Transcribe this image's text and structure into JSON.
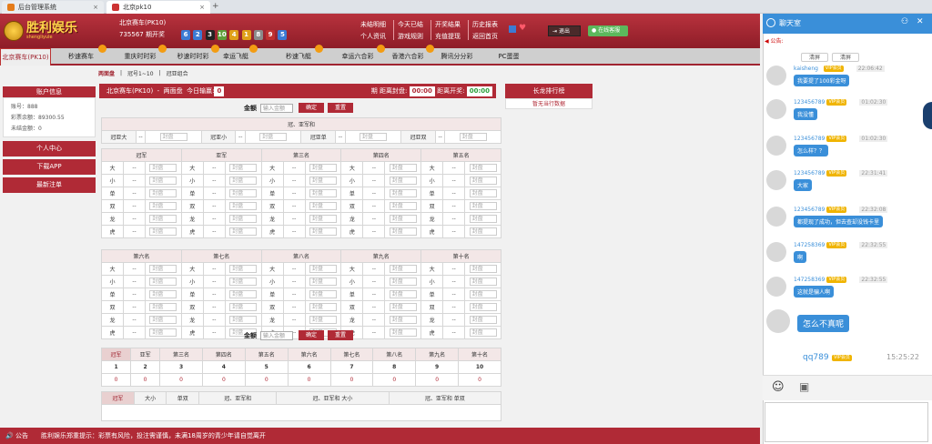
{
  "browser": {
    "tabs": [
      {
        "label": "后台管理系统"
      },
      {
        "label": "北京pk10"
      }
    ],
    "new_tab": "+"
  },
  "header": {
    "logo_main": "胜利娱乐",
    "logo_sub": "shengliyule",
    "game_name": "北京赛车(PK10)",
    "issue": "735567 期开奖",
    "balls": [
      {
        "n": "6",
        "c": "#3c7bd4"
      },
      {
        "n": "2",
        "c": "#3c7bd4"
      },
      {
        "n": "3",
        "c": "#222222"
      },
      {
        "n": "10",
        "c": "#5e9f3a"
      },
      {
        "n": "4",
        "c": "#e0a01a"
      },
      {
        "n": "1",
        "c": "#e0a01a"
      },
      {
        "n": "8",
        "c": "#8b8b8b"
      },
      {
        "n": "9",
        "c": "#c03030"
      },
      {
        "n": "5",
        "c": "#3c7bd4"
      }
    ],
    "links_top": [
      "未结明细",
      "今天已结",
      "开奖结果",
      "历史报表"
    ],
    "links_bottom": [
      "个人资讯",
      "游戏规则",
      "充值提现",
      "返回首页"
    ],
    "exit": "退出",
    "online": "在线客服"
  },
  "nav": {
    "items": [
      "北京赛车(PK10)",
      "秒速赛车",
      "重庆时时彩",
      "秒速时时彩",
      "幸运飞艇",
      "秒速飞艇",
      "幸运六合彩",
      "香港六合彩",
      "腾讯分分彩",
      "PC蛋蛋"
    ]
  },
  "subnav": [
    "两面盘",
    "冠号1~10",
    "冠亚组合"
  ],
  "sidebar": {
    "title": "账户信息",
    "account_label": "账号：",
    "account": "888",
    "balance_label": "彩票余额：",
    "balance": "89300.55",
    "unsettled_label": "未结金额：",
    "unsettled": "0",
    "buttons": [
      "个人中心",
      "下载APP",
      "最新注单"
    ]
  },
  "gamebar": {
    "game": "北京赛车(PK10)",
    "mode": "两面盘",
    "today_label": "今日输赢:",
    "today": "0",
    "close_label": "期 距离封盘:",
    "close": "00:00",
    "open_label": "距离开奖:",
    "open": "00:00"
  },
  "long_dragon": {
    "title": "长龙排行榜",
    "empty": "暂无当行数据"
  },
  "bet": {
    "amount_label": "金额",
    "placeholder": "输入金额",
    "confirm": "确定",
    "reset": "重置",
    "disabled": "封盘",
    "dash": "--"
  },
  "champion": {
    "title": "冠、亚军和",
    "items": [
      "冠亚大",
      "冠亚小",
      "冠亚单",
      "冠亚双"
    ]
  },
  "groups1": [
    "冠军",
    "亚军",
    "第三名",
    "第四名",
    "第五名"
  ],
  "groups2": [
    "第六名",
    "第七名",
    "第八名",
    "第九名",
    "第十名"
  ],
  "options": [
    "大",
    "小",
    "单",
    "双",
    "龙",
    "虎"
  ],
  "summary": {
    "headers": [
      "冠军",
      "亚军",
      "第三名",
      "第四名",
      "第五名",
      "第六名",
      "第七名",
      "第八名",
      "第九名",
      "第十名"
    ],
    "nums": [
      "1",
      "2",
      "3",
      "4",
      "5",
      "6",
      "7",
      "8",
      "9",
      "10"
    ],
    "vals": [
      "0",
      "0",
      "0",
      "0",
      "0",
      "0",
      "0",
      "0",
      "0",
      "0"
    ]
  },
  "tabs2": [
    "冠军",
    "大小",
    "单双",
    "冠、亚军和",
    "冠、亚军和 大小",
    "冠、亚军和 单双"
  ],
  "bottom": {
    "label": "公告",
    "text": "胜利娱乐郑重提示：彩票有风险，投注需谨慎，未满18周岁的青少年请自觉离开"
  },
  "chat": {
    "title": "聊天室",
    "notice": "公告:",
    "btn_a": "清屏",
    "btn_b": "清屏",
    "messages": [
      {
        "user": "kaisheng",
        "badge": "VIP会员",
        "time": "22:06:42",
        "text": "我要提了100彩金呀"
      },
      {
        "user": "123456789",
        "badge": "VIP会员",
        "time": "01:02:30",
        "text": "我没懂"
      },
      {
        "user": "123456789",
        "badge": "VIP会员",
        "time": "01:02:30",
        "text": "怎么样？？"
      },
      {
        "user": "123456789",
        "badge": "VIP会员",
        "time": "22:31:41",
        "text": "大家"
      },
      {
        "user": "123456789",
        "badge": "VIP会员",
        "time": "22:32:08",
        "text": "都提现了成功，但去查却没钱卡里"
      },
      {
        "user": "147258369",
        "badge": "VIP会员",
        "time": "22:32:55",
        "text": "啊"
      },
      {
        "user": "147258369",
        "badge": "VIP会员",
        "time": "22:32:55",
        "text": "这就是骗人啊"
      },
      {
        "user": "qq789",
        "badge": "VIP会员",
        "time": "15:25:22",
        "text": "怎么不真呢"
      }
    ],
    "last_user": "qq789"
  }
}
